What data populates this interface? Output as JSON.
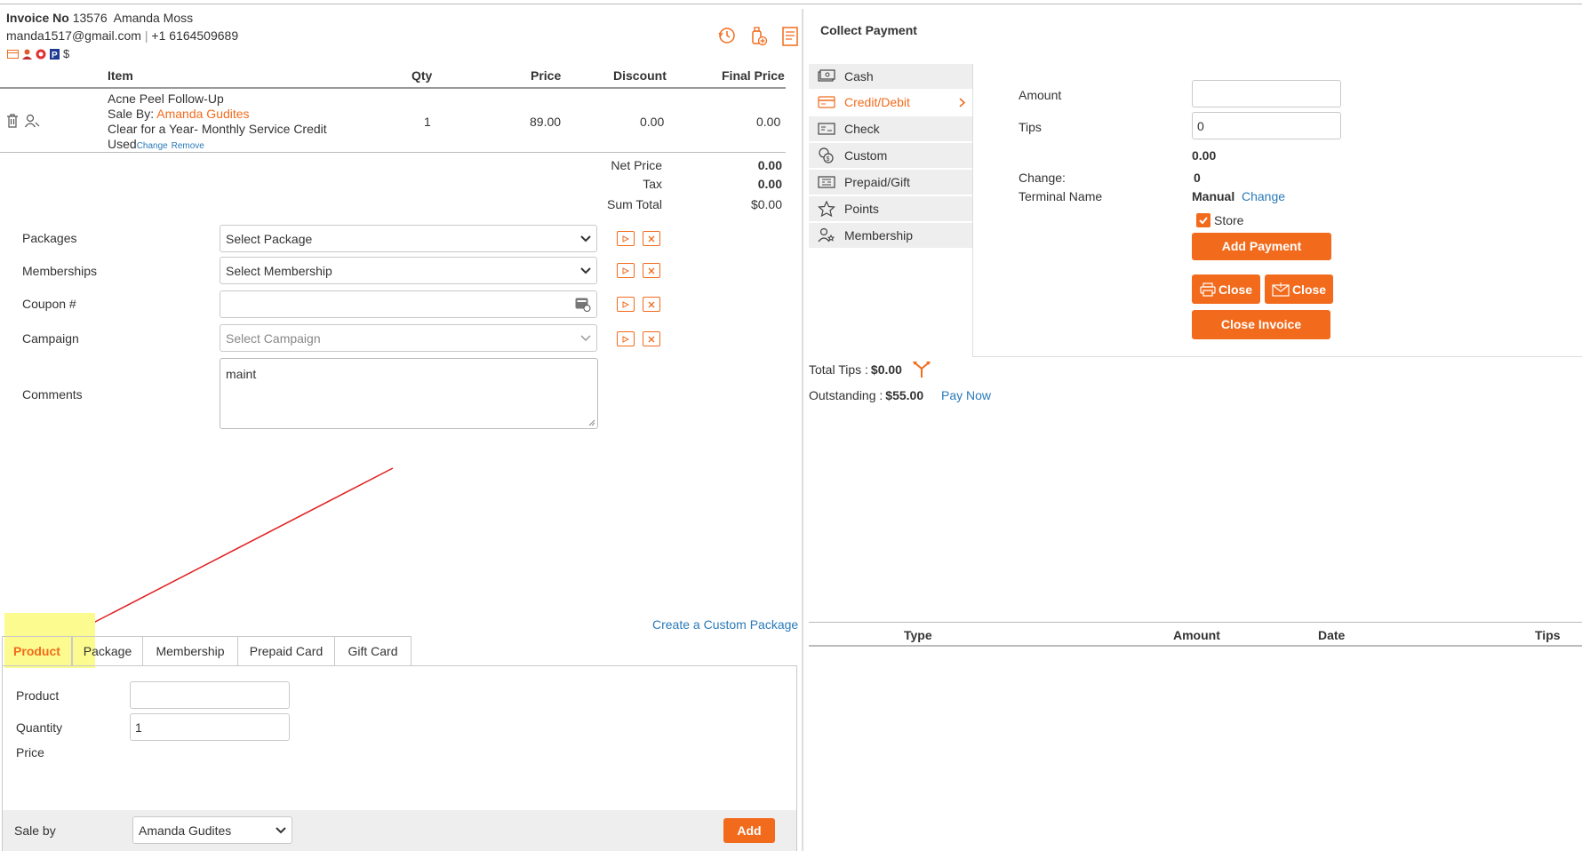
{
  "invoice": {
    "label": "Invoice No",
    "number": "13576",
    "customer": "Amanda Moss",
    "email": "manda1517@gmail.com",
    "separator": "|",
    "phone": "+1 6164509689",
    "dollar": "$"
  },
  "items_table": {
    "headers": [
      "Item",
      "Qty",
      "Price",
      "Discount",
      "Final Price"
    ],
    "rows": [
      {
        "name": "Acne Peel Follow-Up",
        "sale_by_label": "Sale By:",
        "sale_by": "Amanda Gudites",
        "desc": "Clear for a Year- Monthly Service Credit",
        "used": "Used",
        "change": "Change",
        "remove": "Remove",
        "qty": "1",
        "price": "89.00",
        "discount": "0.00",
        "final": "0.00"
      }
    ]
  },
  "totals": {
    "net_label": "Net Price",
    "net": "0.00",
    "tax_label": "Tax",
    "tax": "0.00",
    "sum_label": "Sum Total",
    "sum": "$0.00"
  },
  "form": {
    "packages_label": "Packages",
    "packages_value": "Select Package",
    "memberships_label": "Memberships",
    "memberships_value": "Select Membership",
    "coupon_label": "Coupon #",
    "coupon_value": "",
    "campaign_label": "Campaign",
    "campaign_value": "Select Campaign",
    "comments_label": "Comments",
    "comments_value": "maint"
  },
  "create_custom_package": "Create a Custom Package",
  "tabs": [
    "Product",
    "Package",
    "Membership",
    "Prepaid Card",
    "Gift Card"
  ],
  "product_form": {
    "product_label": "Product",
    "product_value": "",
    "quantity_label": "Quantity",
    "quantity_value": "1",
    "price_label": "Price"
  },
  "footer": {
    "sale_by_label": "Sale by",
    "sale_by_value": "Amanda Gudites",
    "add_label": "Add"
  },
  "payment": {
    "title": "Collect Payment",
    "methods": [
      "Cash",
      "Credit/Debit",
      "Check",
      "Custom",
      "Prepaid/Gift",
      "Points",
      "Membership"
    ],
    "amount_label": "Amount",
    "amount_value": "",
    "tips_label": "Tips",
    "tips_value": "0",
    "subtotal": "0.00",
    "change_label": "Change:",
    "change_value": "0",
    "terminal_label": "Terminal Name",
    "terminal_value": "Manual",
    "terminal_change": "Change",
    "store_label": "Store",
    "add_payment": "Add Payment",
    "close_print": "Close",
    "close_email": "Close",
    "close_invoice": "Close Invoice",
    "total_tips_label": "Total Tips :",
    "total_tips_value": "$0.00",
    "outstanding_label": "Outstanding :",
    "outstanding_value": "$55.00",
    "pay_now": "Pay Now"
  },
  "payments_table": {
    "headers": [
      "Type",
      "Amount",
      "Date",
      "Tips"
    ]
  },
  "colors": {
    "accent": "#f26b1d",
    "link": "#2a7ab9",
    "highlight": "#fbfb8f",
    "arrow": "#e02020"
  }
}
